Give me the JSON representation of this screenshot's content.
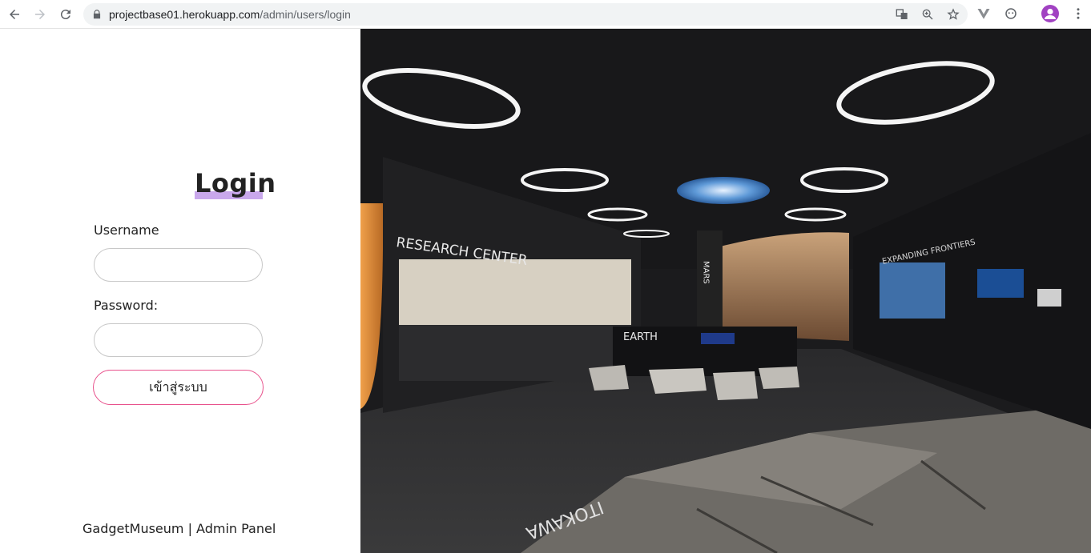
{
  "browser": {
    "url_host": "projectbase01.herokuapp.com",
    "url_path": "/admin/users/login",
    "icons": [
      "back-icon",
      "forward-icon",
      "reload-icon",
      "lock-icon",
      "translate-icon",
      "zoom-icon",
      "star-icon",
      "vuejs-devtools-icon",
      "extension-icon",
      "profile-avatar",
      "menu-icon"
    ]
  },
  "login": {
    "title": "Login",
    "username_label": "Username",
    "username_value": "",
    "password_label": "Password:",
    "password_value": "",
    "submit_label": "เข้าสู่ระบบ"
  },
  "footer": {
    "text": "GadgetMuseum | Admin Panel"
  },
  "hero_image": {
    "signs": [
      "RESEARCH CENTER",
      "MARS",
      "EARTH",
      "EXPANDING FRONTIERS",
      "ITOKAWA"
    ]
  },
  "colors": {
    "accent_underline": "#c9a8ec",
    "button_border": "#e8528c",
    "avatar": "#a142c2"
  }
}
